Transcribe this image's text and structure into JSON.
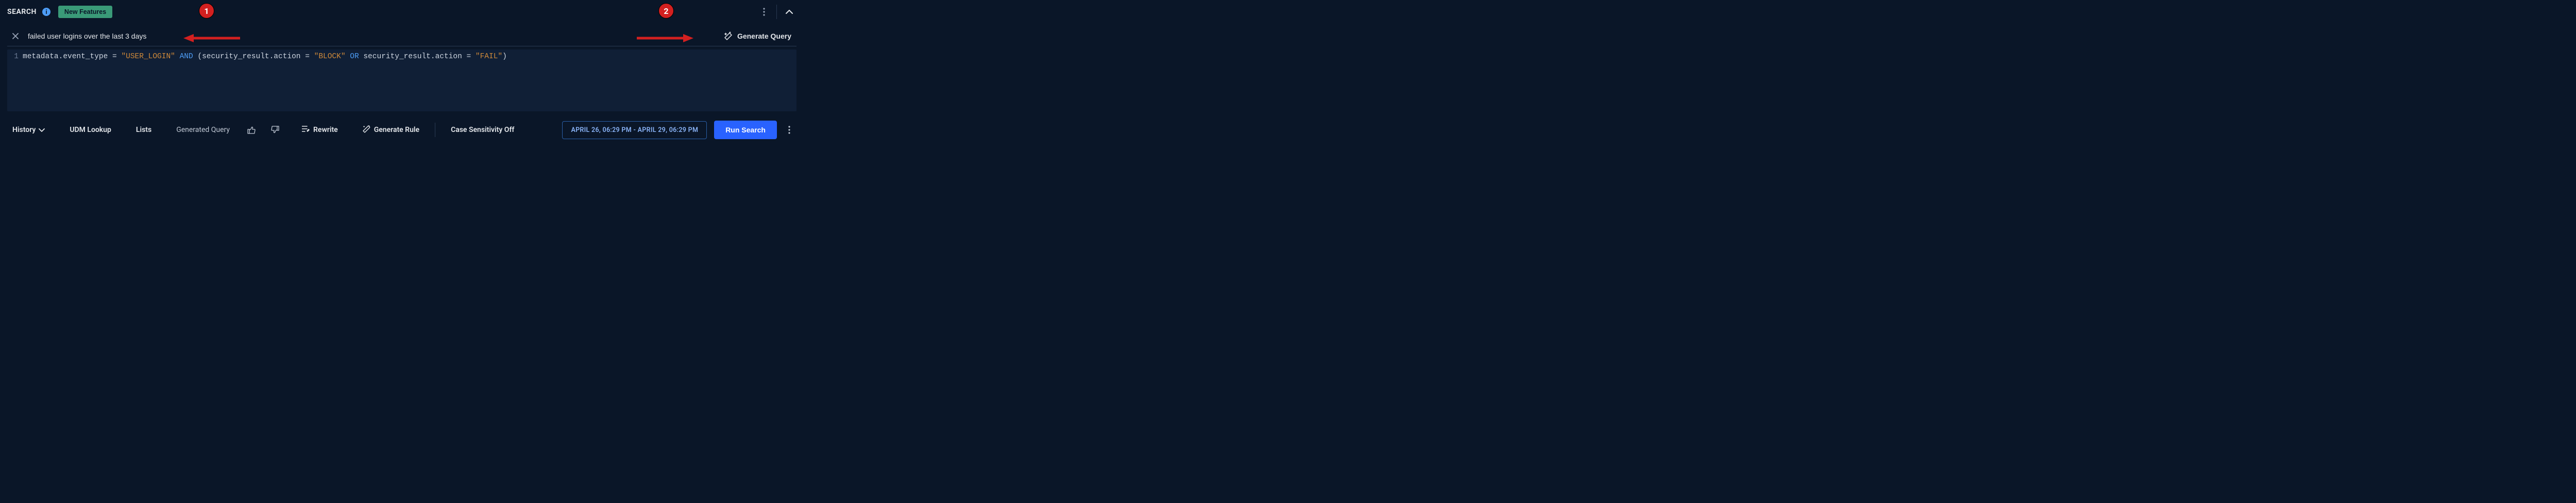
{
  "header": {
    "title": "SEARCH",
    "new_features_label": "New Features"
  },
  "nl": {
    "value": "failed user logins over the last 3 days",
    "generate_label": "Generate Query"
  },
  "editor": {
    "line_number": "1",
    "seg1_id": "metadata.event_type",
    "seg2_punc": " = ",
    "seg3_str": "\"USER_LOGIN\"",
    "seg4_sp": " ",
    "seg5_kw": "AND",
    "seg6_sp": " (",
    "seg7_id": "security_result.action",
    "seg8_punc": " = ",
    "seg9_str": "\"BLOCK\"",
    "seg10_sp": " ",
    "seg11_kw": "OR",
    "seg12_sp": " ",
    "seg13_id": "security_result.action",
    "seg14_punc": " = ",
    "seg15_str": "\"FAIL\"",
    "seg16_sp": ")"
  },
  "toolbar": {
    "history": "History",
    "udm_lookup": "UDM Lookup",
    "lists": "Lists",
    "generated_query": "Generated Query",
    "rewrite": "Rewrite",
    "generate_rule": "Generate Rule",
    "case_sensitivity": "Case Sensitivity Off",
    "time_range": "APRIL 26, 06:29 PM - APRIL 29, 06:29 PM",
    "run": "Run Search"
  },
  "annotations": {
    "badge1": "1",
    "badge2": "2"
  }
}
